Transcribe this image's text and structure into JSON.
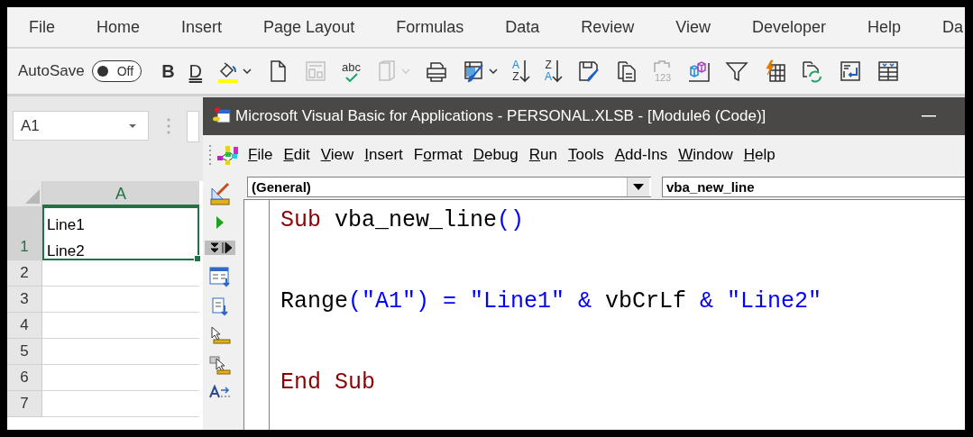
{
  "excel": {
    "ribbon_tabs": [
      {
        "label": "File",
        "selected": false
      },
      {
        "label": "Home",
        "selected": false
      },
      {
        "label": "Insert",
        "selected": false
      },
      {
        "label": "Page Layout",
        "selected": false
      },
      {
        "label": "Formulas",
        "selected": false
      },
      {
        "label": "Data",
        "selected": false
      },
      {
        "label": "Review",
        "selected": false
      },
      {
        "label": "View",
        "selected": false
      },
      {
        "label": "Developer",
        "selected": false
      },
      {
        "label": "Help",
        "selected": false
      },
      {
        "label": "Da",
        "selected": false
      }
    ],
    "autosave": {
      "label": "AutoSave",
      "on": false,
      "state_text": "Off"
    },
    "toolbar": [
      {
        "kind": "bold",
        "text": "B",
        "disabled": false
      },
      {
        "kind": "underline",
        "text": "D",
        "disabled": false
      },
      {
        "kind": "fill",
        "has_menu": true,
        "disabled": false
      },
      {
        "kind": "page",
        "disabled": false
      },
      {
        "kind": "layout",
        "disabled": true
      },
      {
        "kind": "spelling",
        "text": "abc",
        "disabled": false
      },
      {
        "kind": "book",
        "has_menu": true,
        "disabled": true
      },
      {
        "kind": "print",
        "disabled": false
      },
      {
        "kind": "painter",
        "has_menu": true,
        "disabled": false
      },
      {
        "kind": "sortaz",
        "text": "A",
        "text2": "Z",
        "disabled": false
      },
      {
        "kind": "sortza",
        "text": "Z",
        "text2": "A",
        "disabled": false
      },
      {
        "kind": "saveedit",
        "disabled": false
      },
      {
        "kind": "copy",
        "disabled": false
      },
      {
        "kind": "pastevalues",
        "text": "123",
        "disabled": true
      },
      {
        "kind": "cubes",
        "disabled": false
      },
      {
        "kind": "filter",
        "disabled": false
      },
      {
        "kind": "flash",
        "disabled": false
      },
      {
        "kind": "refresh",
        "disabled": false
      },
      {
        "kind": "relink",
        "disabled": false
      },
      {
        "kind": "table",
        "disabled": false
      }
    ],
    "name_box": "A1",
    "columns": [
      "A"
    ],
    "rows": [
      {
        "header": "1",
        "cell_lines": [
          "Line1",
          "Line2"
        ],
        "selected": true
      },
      {
        "header": "2",
        "selected": false
      },
      {
        "header": "3",
        "selected": false
      },
      {
        "header": "4",
        "selected": false
      },
      {
        "header": "5",
        "selected": false
      },
      {
        "header": "6",
        "selected": false
      },
      {
        "header": "7",
        "selected": false
      }
    ]
  },
  "vba": {
    "title": "Microsoft Visual Basic for Applications - PERSONAL.XLSB - [Module6 (Code)]",
    "menu": [
      {
        "key": "F",
        "after": "ile"
      },
      {
        "key": "E",
        "after": "dit"
      },
      {
        "key": "V",
        "after": "iew"
      },
      {
        "key": "I",
        "after": "nsert"
      },
      {
        "before": "F",
        "key": "o",
        "after": "rmat"
      },
      {
        "key": "D",
        "after": "ebug"
      },
      {
        "key": "R",
        "after": "un"
      },
      {
        "key": "T",
        "after": "ools"
      },
      {
        "key": "A",
        "after": "dd-Ins"
      },
      {
        "key": "W",
        "after": "indow"
      },
      {
        "key": "H",
        "after": "elp"
      }
    ],
    "object_dropdown": "(General)",
    "procedure_dropdown": "vba_new_line",
    "code_lines": [
      {
        "tokens": [
          {
            "text": "Sub ",
            "kind": "keyword"
          },
          {
            "text": "vba_new_line",
            "kind": "identifier"
          },
          {
            "text": "()",
            "kind": "symbol"
          }
        ]
      },
      {
        "tokens": [
          {
            "text": "Range",
            "kind": "identifier"
          },
          {
            "text": "(\"A1\") = \"Line1\" & ",
            "kind": "symbol"
          },
          {
            "text": "vbCrLf ",
            "kind": "identifier"
          },
          {
            "text": "& \"Line2\"",
            "kind": "symbol"
          }
        ]
      },
      {
        "tokens": [
          {
            "text": "End Sub",
            "kind": "keyword"
          }
        ]
      }
    ]
  }
}
